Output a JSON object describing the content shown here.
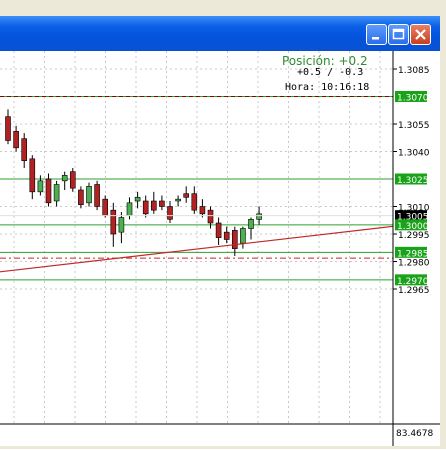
{
  "window": {
    "minimize_icon": "minimize-icon",
    "maximize_icon": "maximize-icon",
    "close_icon": "close-icon"
  },
  "info": {
    "position_title": "Posición: +0.2",
    "position_values": "+0.5 / -0.3",
    "time_label": "Hora: 10:16:18"
  },
  "price_axis": {
    "ticks": [
      "1.3085",
      "1.3055",
      "1.3040",
      "1.3010",
      "1.2995",
      "1.2980",
      "1.2965"
    ]
  },
  "level_boxes": [
    {
      "label": "1.3070",
      "color": "#008000",
      "style": "green-dark-dash"
    },
    {
      "label": "1.3025",
      "color": "#00a000",
      "style": "green"
    },
    {
      "label": "1.3005",
      "color": "#000000",
      "style": "current-price"
    },
    {
      "label": "1.3000",
      "color": "#00a000",
      "style": "green"
    },
    {
      "label": "1.2985",
      "color": "#00a000",
      "style": "green-red-dash"
    },
    {
      "label": "1.2970",
      "color": "#00a000",
      "style": "green"
    }
  ],
  "indicator": {
    "label": "83.4678"
  },
  "chart_data": {
    "type": "candlestick",
    "price_min": 1.2958,
    "price_max": 1.3092,
    "levels": [
      1.307,
      1.3025,
      1.3,
      1.2985,
      1.297
    ],
    "dashed_levels": [
      1.307,
      1.2984
    ],
    "current_price": 1.3005,
    "trendline": [
      {
        "i": 0,
        "price": 1.2982
      },
      {
        "i": 55,
        "price": 1.2998
      }
    ],
    "candles": [
      {
        "o": 1.3059,
        "h": 1.3063,
        "l": 1.3044,
        "c": 1.3046
      },
      {
        "o": 1.3051,
        "h": 1.3054,
        "l": 1.304,
        "c": 1.3042
      },
      {
        "o": 1.3047,
        "h": 1.305,
        "l": 1.3031,
        "c": 1.3035
      },
      {
        "o": 1.3036,
        "h": 1.3038,
        "l": 1.3014,
        "c": 1.3018
      },
      {
        "o": 1.3018,
        "h": 1.3027,
        "l": 1.3016,
        "c": 1.3024
      },
      {
        "o": 1.3025,
        "h": 1.3028,
        "l": 1.301,
        "c": 1.3012
      },
      {
        "o": 1.3013,
        "h": 1.3024,
        "l": 1.301,
        "c": 1.3022
      },
      {
        "o": 1.3024,
        "h": 1.3029,
        "l": 1.3019,
        "c": 1.3027
      },
      {
        "o": 1.3029,
        "h": 1.3031,
        "l": 1.3018,
        "c": 1.302
      },
      {
        "o": 1.3019,
        "h": 1.3021,
        "l": 1.3009,
        "c": 1.3011
      },
      {
        "o": 1.3012,
        "h": 1.3023,
        "l": 1.301,
        "c": 1.3021
      },
      {
        "o": 1.3022,
        "h": 1.3024,
        "l": 1.3008,
        "c": 1.301
      },
      {
        "o": 1.3014,
        "h": 1.3016,
        "l": 1.3004,
        "c": 1.3005
      },
      {
        "o": 1.3008,
        "h": 1.3012,
        "l": 1.2988,
        "c": 1.2995
      },
      {
        "o": 1.2996,
        "h": 1.3007,
        "l": 1.299,
        "c": 1.3004
      },
      {
        "o": 1.3005,
        "h": 1.3015,
        "l": 1.3003,
        "c": 1.3012
      },
      {
        "o": 1.3013,
        "h": 1.3018,
        "l": 1.3009,
        "c": 1.3015
      },
      {
        "o": 1.3013,
        "h": 1.3016,
        "l": 1.3004,
        "c": 1.3006
      },
      {
        "o": 1.3013,
        "h": 1.3018,
        "l": 1.3006,
        "c": 1.3008
      },
      {
        "o": 1.3013,
        "h": 1.3016,
        "l": 1.3008,
        "c": 1.301
      },
      {
        "o": 1.301,
        "h": 1.3013,
        "l": 1.3001,
        "c": 1.3003
      },
      {
        "o": 1.3013,
        "h": 1.3016,
        "l": 1.301,
        "c": 1.3014
      },
      {
        "o": 1.3017,
        "h": 1.3021,
        "l": 1.3012,
        "c": 1.3015
      },
      {
        "o": 1.3017,
        "h": 1.3021,
        "l": 1.3006,
        "c": 1.3008
      },
      {
        "o": 1.301,
        "h": 1.3014,
        "l": 1.3004,
        "c": 1.3006
      },
      {
        "o": 1.3008,
        "h": 1.301,
        "l": 1.2998,
        "c": 1.3001
      },
      {
        "o": 1.3001,
        "h": 1.3004,
        "l": 1.2989,
        "c": 1.2993
      },
      {
        "o": 1.2996,
        "h": 1.2999,
        "l": 1.299,
        "c": 1.2992
      },
      {
        "o": 1.2997,
        "h": 1.2999,
        "l": 1.2983,
        "c": 1.2987
      },
      {
        "o": 1.299,
        "h": 1.2999,
        "l": 1.2987,
        "c": 1.2998
      },
      {
        "o": 1.2998,
        "h": 1.3004,
        "l": 1.2992,
        "c": 1.3003
      },
      {
        "o": 1.3003,
        "h": 1.301,
        "l": 1.3,
        "c": 1.3006
      }
    ]
  }
}
